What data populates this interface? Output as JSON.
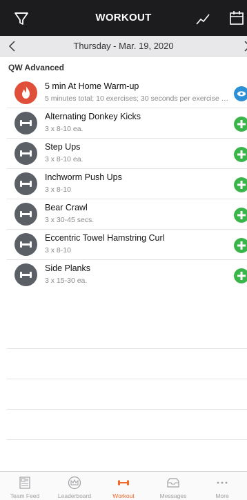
{
  "header": {
    "title": "WORKOUT",
    "left_icon": "filter-icon",
    "right_icons": [
      "trend-icon",
      "calendar-icon"
    ]
  },
  "datebar": {
    "date": "Thursday - Mar. 19, 2020"
  },
  "section_title": "QW Advanced",
  "exercises": [
    {
      "name": "5 min At Home Warm-up",
      "detail": "5 minutes total; 10 exercises; 30 seconds per exercise (fol…",
      "icon": "fire-icon",
      "action": "view-icon"
    },
    {
      "name": "Alternating Donkey Kicks",
      "detail": "3 x 8-10 ea.",
      "icon": "dumbbell-icon",
      "action": "add-icon"
    },
    {
      "name": "Step Ups",
      "detail": "3 x 8-10 ea.",
      "icon": "dumbbell-icon",
      "action": "add-icon"
    },
    {
      "name": "Inchworm Push Ups",
      "detail": "3 x 8-10",
      "icon": "dumbbell-icon",
      "action": "add-icon"
    },
    {
      "name": "Bear Crawl",
      "detail": "3 x 30-45 secs.",
      "icon": "dumbbell-icon",
      "action": "add-icon"
    },
    {
      "name": "Eccentric Towel Hamstring Curl",
      "detail": "3 x 8-10",
      "icon": "dumbbell-icon",
      "action": "add-icon"
    },
    {
      "name": "Side Planks",
      "detail": "3 x 15-30 ea.",
      "icon": "dumbbell-icon",
      "action": "add-icon"
    }
  ],
  "tabs": [
    {
      "label": "Team Feed",
      "icon": "feed-icon",
      "active": false
    },
    {
      "label": "Leaderboard",
      "icon": "crown-icon",
      "active": false
    },
    {
      "label": "Workout",
      "icon": "dumbbell-icon",
      "active": true
    },
    {
      "label": "Messages",
      "icon": "inbox-icon",
      "active": false
    },
    {
      "label": "More",
      "icon": "more-icon",
      "active": false
    }
  ],
  "colors": {
    "header_bg": "#1c1c1e",
    "add_green": "#3ab54a",
    "view_blue": "#2d8fd5",
    "fire_red": "#e04f39",
    "active_orange": "#ef6a2b"
  }
}
